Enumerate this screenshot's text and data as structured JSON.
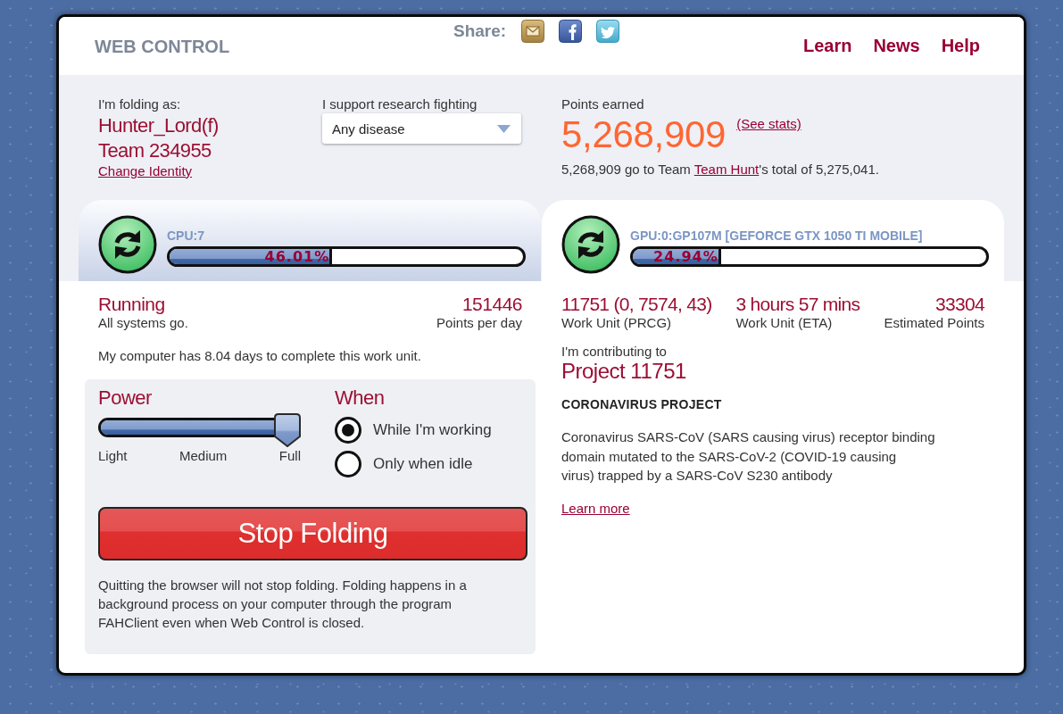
{
  "header": {
    "title": "WEB CONTROL",
    "share_label": "Share:",
    "nav": [
      "Learn",
      "News",
      "Help"
    ]
  },
  "identity": {
    "label": "I'm folding as:",
    "user": "Hunter_Lord(f)",
    "team": "Team 234955",
    "change_link": "Change Identity"
  },
  "cause": {
    "label": "I support research fighting",
    "value": "Any disease"
  },
  "points": {
    "label": "Points earned",
    "total": "5,268,909",
    "stats_link": "(See stats)",
    "summary": {
      "before": "5,268,909 go to Team ",
      "team_link": "Team Hunt",
      "after": "'s total of 5,275,041."
    }
  },
  "slots": [
    {
      "name": "CPU:7",
      "selected": false,
      "level": 0.4601,
      "reading": "46.01%"
    },
    {
      "name": "GPU:0:GP107M [GEFORCE GTX 1050 TI MOBILE]",
      "selected": true,
      "level": 0.2494,
      "reading": "24.94%"
    }
  ],
  "status": {
    "state": "Running",
    "message": "All systems go.",
    "ppd": "151446",
    "ppd_label": "Points per day",
    "eta_note": "My computer has 8.04 days to complete this work unit."
  },
  "power": {
    "heading": "Power",
    "level": 1,
    "labels": [
      "Light",
      "Medium",
      "Full"
    ]
  },
  "when": {
    "heading": "When",
    "options": [
      {
        "label": "While I'm working",
        "selected": true
      },
      {
        "label": "Only when idle",
        "selected": false
      }
    ]
  },
  "stop_button": "Stop Folding",
  "note": "Quitting the browser will not stop folding. Folding happens in a background process on your computer through the program FAHClient even when Web Control is closed.",
  "work_unit": {
    "stats": [
      {
        "value": "11751 (0, 7574, 43)",
        "label": "Work Unit (PRCG)"
      },
      {
        "value": "3 hours 57 mins",
        "label": "Work Unit (ETA)"
      },
      {
        "value": "33304",
        "label": "Estimated Points"
      }
    ],
    "contributing_label": "I'm contributing to",
    "project": "Project 11751",
    "project_title": "CORONAVIRUS PROJECT",
    "description": "Coronavirus SARS-CoV (SARS causing virus) receptor binding domain mutated to the SARS-CoV-2 (COVID-19 causing\nvirus) trapped by a SARS-CoV S230 antibody",
    "learn_more": "Learn more"
  }
}
